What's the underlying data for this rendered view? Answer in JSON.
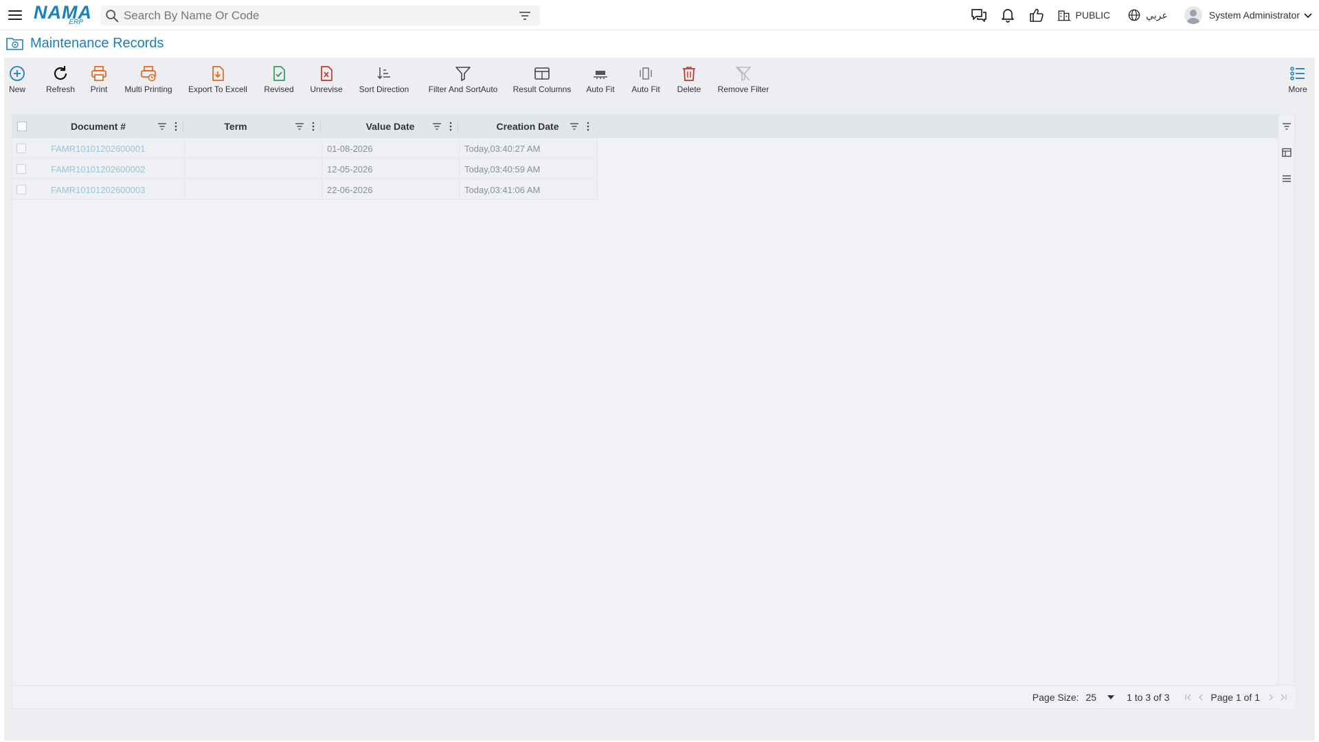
{
  "app": {
    "logo_text": "NAMA",
    "logo_sub": "ERP"
  },
  "search": {
    "placeholder": "Search By Name Or Code"
  },
  "topbar": {
    "branch": "PUBLIC",
    "language": "عربي",
    "user": "System Administrator",
    "icons": [
      "chat-icon",
      "bell-icon",
      "thumbs-up-icon",
      "building-icon",
      "globe-icon",
      "user-avatar",
      "chevron-down-icon"
    ]
  },
  "page": {
    "title": "Maintenance Records"
  },
  "toolbar": {
    "new": "New",
    "refresh": "Refresh",
    "print": "Print",
    "multi_printing": "Multi Printing",
    "export_excel": "Export To Excell",
    "revised": "Revised",
    "unrevise": "Unrevise",
    "sort_direction": "Sort Direction",
    "filter_sort_auto": "Filter And SortAuto",
    "result_columns": "Result Columns",
    "auto_fit_1": "Auto Fit",
    "auto_fit_2": "Auto Fit",
    "delete": "Delete",
    "remove_filter": "Remove Filter",
    "more": "More"
  },
  "grid": {
    "columns": [
      "Document #",
      "Term",
      "Value Date",
      "Creation Date"
    ],
    "rows": [
      {
        "document": "FAMR10101202600001",
        "term": "",
        "value_date": "01-08-2026",
        "creation_date": "Today,03:40:27 AM"
      },
      {
        "document": "FAMR10101202600002",
        "term": "",
        "value_date": "12-05-2026",
        "creation_date": "Today,03:40:59 AM"
      },
      {
        "document": "FAMR10101202600003",
        "term": "",
        "value_date": "22-06-2026",
        "creation_date": "Today,03:41:06 AM"
      }
    ]
  },
  "footer": {
    "page_size_label": "Page Size:",
    "page_size": "25",
    "range": "1 to 3 of 3",
    "page_info": "Page 1 of 1"
  },
  "colors": {
    "brand": "#1a7fc1",
    "orange": "#e8641b",
    "green": "#2e9e4f",
    "red": "#c0392b"
  }
}
